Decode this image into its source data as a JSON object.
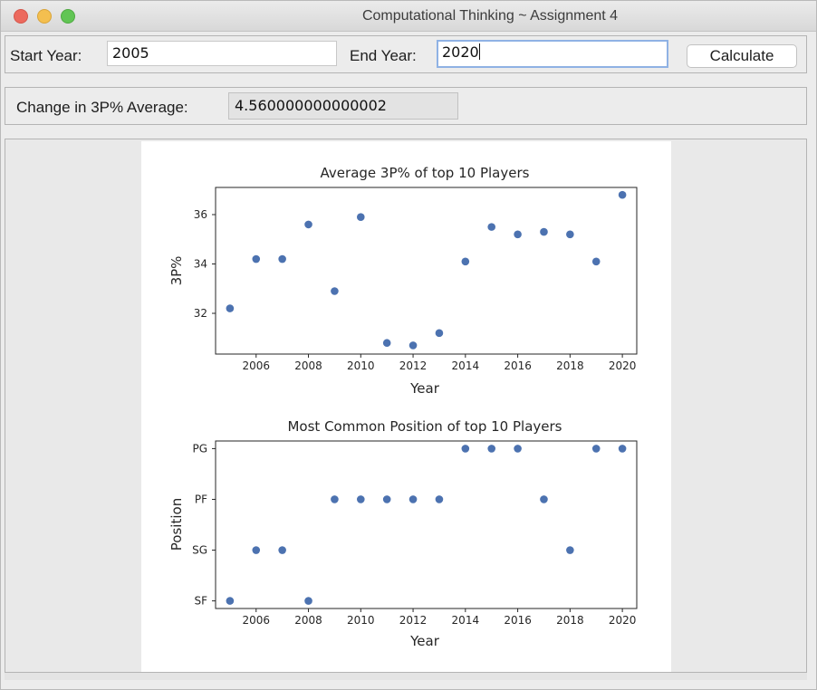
{
  "window": {
    "title": "Computational Thinking ~ Assignment 4"
  },
  "inputs": {
    "start_label": "Start Year:",
    "start_value": "2005",
    "end_label": "End Year:",
    "end_value": "2020",
    "calculate_label": "Calculate"
  },
  "result": {
    "label": "Change in 3P% Average:",
    "value": "4.560000000000002"
  },
  "colors": {
    "marker": "#4c72b0"
  },
  "chart_data": [
    {
      "type": "scatter",
      "title": "Average 3P% of top 10 Players",
      "xlabel": "Year",
      "ylabel": "3P%",
      "xlim": [
        2004.45,
        2020.55
      ],
      "ylim": [
        30.35,
        37.1
      ],
      "xticks": [
        2006,
        2008,
        2010,
        2012,
        2014,
        2016,
        2018,
        2020
      ],
      "yticks": [
        32,
        34,
        36
      ],
      "x": [
        2005,
        2006,
        2007,
        2008,
        2009,
        2010,
        2011,
        2012,
        2013,
        2014,
        2015,
        2016,
        2017,
        2018,
        2019,
        2020
      ],
      "y": [
        32.2,
        34.2,
        34.2,
        35.6,
        32.9,
        35.9,
        30.8,
        30.7,
        31.2,
        34.1,
        35.5,
        35.2,
        35.3,
        35.2,
        34.1,
        36.8
      ]
    },
    {
      "type": "scatter",
      "title": "Most Common Position of top 10 Players",
      "xlabel": "Year",
      "ylabel": "Position",
      "xlim": [
        2004.45,
        2020.55
      ],
      "xticks": [
        2006,
        2008,
        2010,
        2012,
        2014,
        2016,
        2018,
        2020
      ],
      "y_categories": [
        "SF",
        "SG",
        "PF",
        "PG"
      ],
      "x": [
        2005,
        2006,
        2007,
        2008,
        2009,
        2010,
        2011,
        2012,
        2013,
        2014,
        2015,
        2016,
        2017,
        2018,
        2019,
        2020
      ],
      "y": [
        "SF",
        "SG",
        "SG",
        "SF",
        "PF",
        "PF",
        "PF",
        "PF",
        "PF",
        "PG",
        "PG",
        "PG",
        "PF",
        "SG",
        "PG",
        "PG"
      ]
    }
  ]
}
